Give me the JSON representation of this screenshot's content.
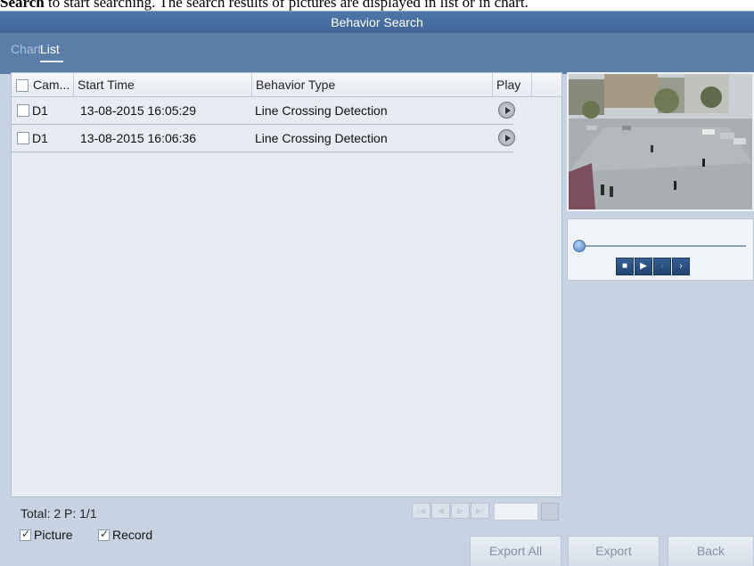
{
  "doc_caption": {
    "bold": "Search",
    "rest": " to start searching. The search results of pictures are displayed in list or in chart."
  },
  "window": {
    "title": "Behavior Search"
  },
  "tabs": [
    {
      "label": "Chart",
      "active": false
    },
    {
      "label": "List",
      "active": true
    }
  ],
  "table": {
    "headers": [
      "Cam...",
      "Start Time",
      "Behavior Type",
      "Play"
    ],
    "rows": [
      {
        "camera": "D1",
        "start_time": "13-08-2015 16:05:29",
        "behavior_type": "Line Crossing Detection"
      },
      {
        "camera": "D1",
        "start_time": "13-08-2015 16:06:36",
        "behavior_type": "Line Crossing Detection"
      }
    ]
  },
  "footer": {
    "total": "Total: 2  P: 1/1"
  },
  "playback_controls": {
    "progress": 0,
    "buttons": [
      "stop-icon",
      "play-icon",
      "chevron-left-icon",
      "chevron-right-icon"
    ]
  },
  "options": {
    "picture": {
      "label": "Picture",
      "checked": true
    },
    "record": {
      "label": "Record",
      "checked": true
    }
  },
  "buttons": {
    "export_all": "Export All",
    "export": "Export",
    "back": "Back"
  },
  "colors": {
    "title_bar": "#4a70a0",
    "tab_bar": "#5b7ea8",
    "panel_bg": "#c7d3e2"
  }
}
